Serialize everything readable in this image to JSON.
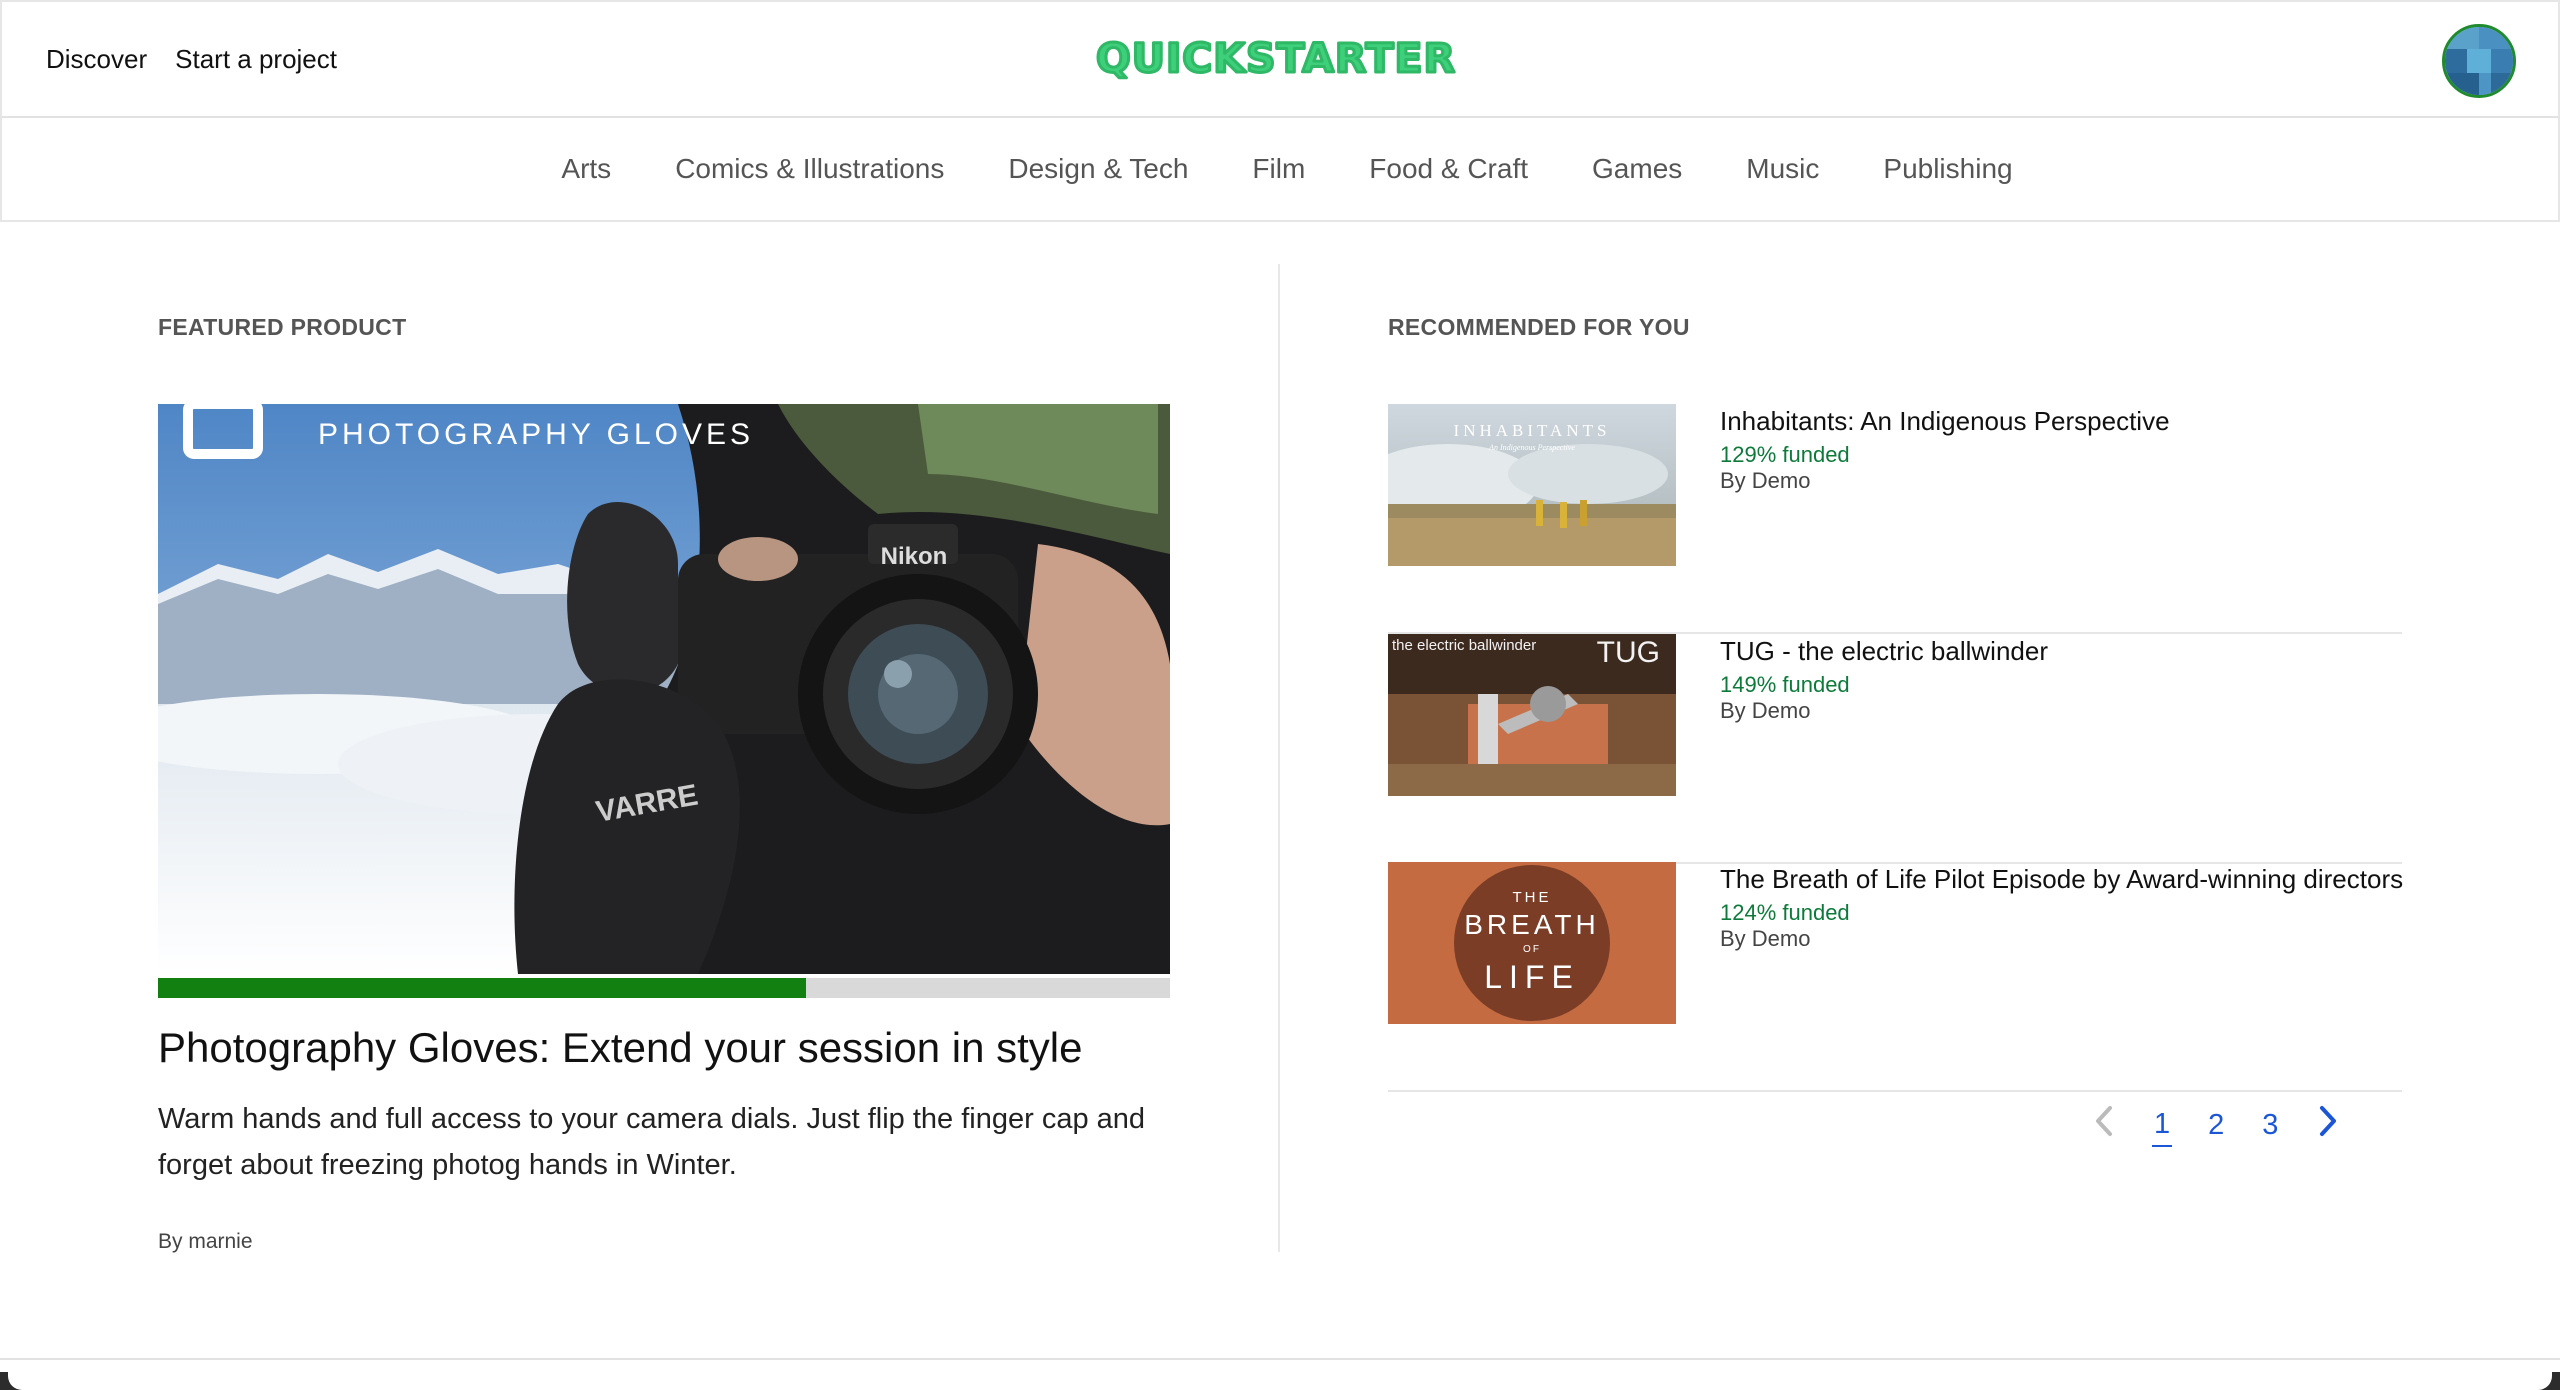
{
  "header": {
    "links": [
      "Discover",
      "Start a project"
    ],
    "logo_text": "QUICKSTARTER"
  },
  "categories": [
    "Arts",
    "Comics & Illustrations",
    "Design & Tech",
    "Film",
    "Food & Craft",
    "Games",
    "Music",
    "Publishing"
  ],
  "featured": {
    "section_label": "FEATURED PRODUCT",
    "title": "Photography Gloves: Extend your session in style",
    "description": "Warm hands and full access to your camera dials. Just flip the finger cap and forget about freezing photog hands in Winter.",
    "by": "By marnie",
    "progress_fraction": 0.64,
    "image_text": "PHOTOGRAPHY GLOVES",
    "camera_brand": "Nikon"
  },
  "recommended": {
    "section_label": "RECOMMENDED FOR YOU",
    "items": [
      {
        "title": "Inhabitants: An Indigenous Perspective",
        "funded": "129% funded",
        "by": "By Demo",
        "thumb_text": "INHABITANTS",
        "thumb_subtext": "An Indigenous Perspective"
      },
      {
        "title": "TUG - the electric ballwinder",
        "funded": "149% funded",
        "by": "By Demo",
        "thumb_text": "TUG",
        "thumb_subtext": "the electric ballwinder"
      },
      {
        "title": "The Breath of Life Pilot Episode by Award-winning directors",
        "funded": "124% funded",
        "by": "By Demo",
        "thumb_text_1": "THE",
        "thumb_text_2": "BREATH",
        "thumb_text_3": "OF",
        "thumb_text_4": "LIFE"
      }
    ]
  },
  "pagination": {
    "pages": [
      "1",
      "2",
      "3"
    ],
    "current": "1"
  },
  "colors": {
    "logo_green": "#3ecf7a",
    "progress_green": "#118011",
    "funded_green": "#0d7a3a",
    "link_blue": "#1a56d6"
  }
}
